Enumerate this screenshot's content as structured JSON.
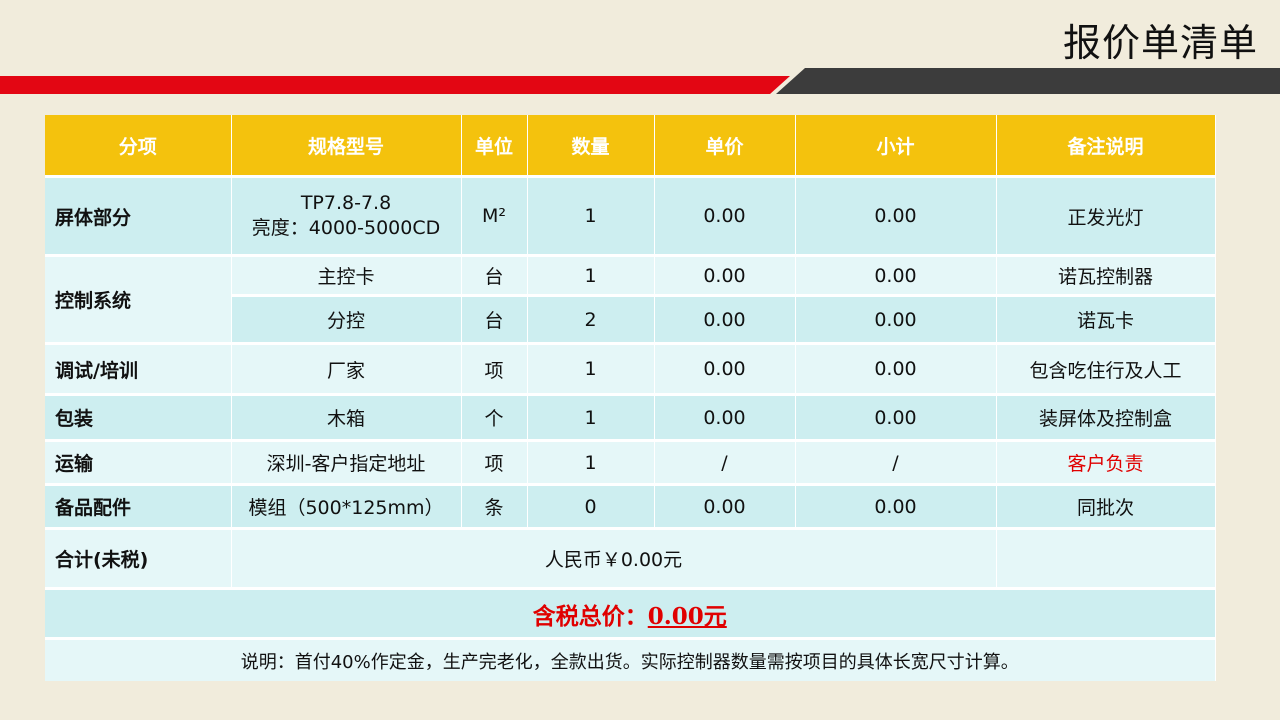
{
  "title": "报价单清单",
  "colors": {
    "accent_red": "#e30613",
    "dark_band": "#3c3c3c",
    "header_yellow": "#f4c20d",
    "row_cyan": "#cdeef0",
    "row_light": "#e5f7f8"
  },
  "table": {
    "headers": [
      "分项",
      "规格型号",
      "单位",
      "数量",
      "单价",
      "小计",
      "备注说明"
    ],
    "rows": [
      {
        "category": "屏体部分",
        "spec_line1": "TP7.8-7.8",
        "spec_line2": "亮度：4000-5000CD",
        "unit": "M²",
        "qty": "1",
        "price": "0.00",
        "subtotal": "0.00",
        "note": "正发光灯"
      },
      {
        "category": "控制系统",
        "spec": "主控卡",
        "unit": "台",
        "qty": "1",
        "price": "0.00",
        "subtotal": "0.00",
        "note": "诺瓦控制器"
      },
      {
        "spec": "分控",
        "unit": "台",
        "qty": "2",
        "price": "0.00",
        "subtotal": "0.00",
        "note": "诺瓦卡"
      },
      {
        "category": "调试/培训",
        "spec": "厂家",
        "unit": "项",
        "qty": "1",
        "price": "0.00",
        "subtotal": "0.00",
        "note": "包含吃住行及人工"
      },
      {
        "category": "包装",
        "spec": "木箱",
        "unit": "个",
        "qty": "1",
        "price": "0.00",
        "subtotal": "0.00",
        "note": "装屏体及控制盒"
      },
      {
        "category": "运输",
        "spec": "深圳-客户指定地址",
        "unit": "项",
        "qty": "1",
        "price": "/",
        "subtotal": "/",
        "note": "客户负责"
      },
      {
        "category": "备品配件",
        "spec": "模组（500*125mm）",
        "unit": "条",
        "qty": "0",
        "price": "0.00",
        "subtotal": "0.00",
        "note": "同批次"
      }
    ],
    "total_label": "合计(未税)",
    "total_value": "人民币￥0.00元",
    "tax_label": "含税总价：",
    "tax_value": "0.00元",
    "remark": "说明：首付40%作定金，生产完老化，全款出货。实际控制器数量需按项目的具体长宽尺寸计算。"
  }
}
